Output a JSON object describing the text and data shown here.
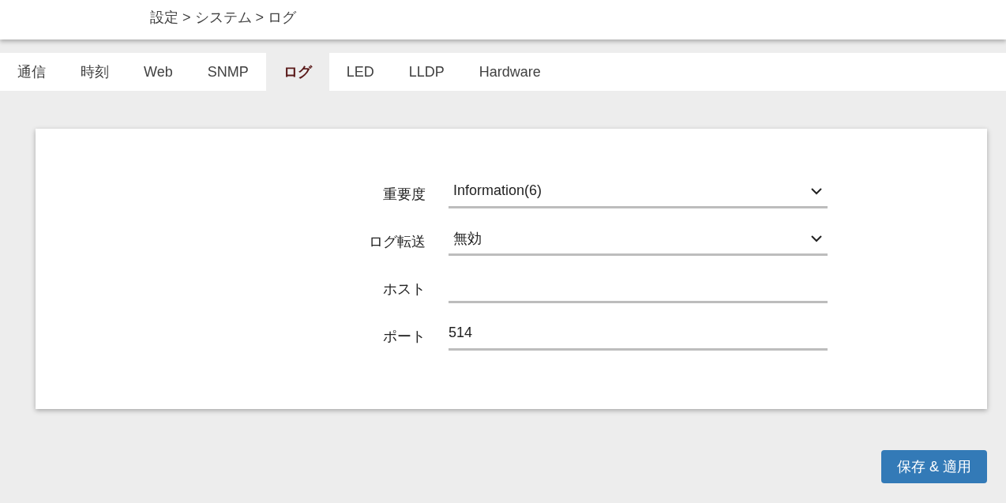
{
  "breadcrumb": "設定 > システム > ログ",
  "tabs": [
    {
      "label": "通信",
      "selected": false
    },
    {
      "label": "時刻",
      "selected": false
    },
    {
      "label": "Web",
      "selected": false
    },
    {
      "label": "SNMP",
      "selected": false
    },
    {
      "label": "ログ",
      "selected": true
    },
    {
      "label": "LED",
      "selected": false
    },
    {
      "label": "LLDP",
      "selected": false
    },
    {
      "label": "Hardware",
      "selected": false
    }
  ],
  "fields": [
    {
      "label": "重要度",
      "kind": "select",
      "value": "Information(6)"
    },
    {
      "label": "ログ転送",
      "kind": "select",
      "value": "無効"
    },
    {
      "label": "ホスト",
      "kind": "input"
    },
    {
      "label": "ポート",
      "kind": "input",
      "value": "514"
    }
  ],
  "buttons": [
    "保存 & 適用"
  ]
}
